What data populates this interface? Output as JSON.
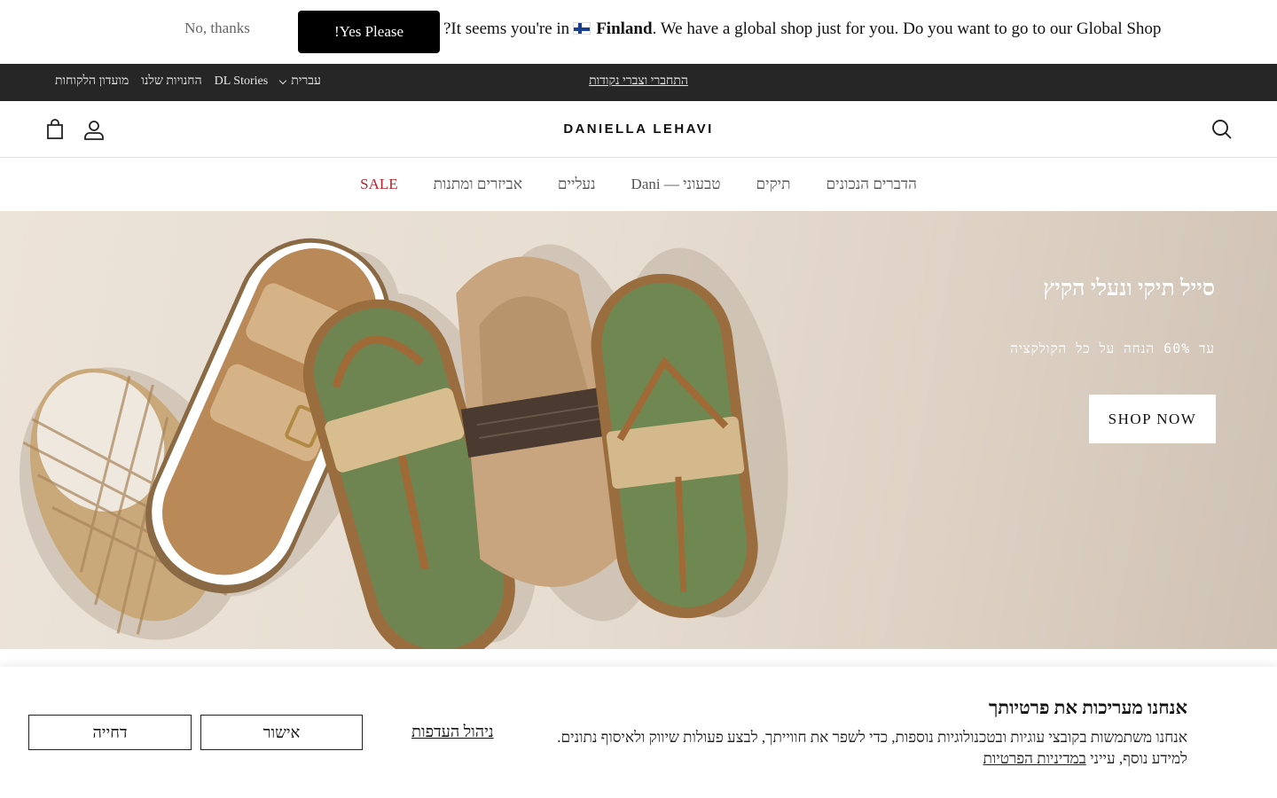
{
  "geo_banner": {
    "no_thanks": "No, thanks",
    "yes_please": "!Yes Please",
    "message_prefix": "?It seems you're in",
    "country": "Finland",
    "message_suffix": ". We have a global shop just for you. Do you want to go to our Global Shop"
  },
  "topbar": {
    "links": [
      "מועדון הלקוחות",
      "החנויות שלנו",
      "DL Stories"
    ],
    "language": "עברית",
    "promo": "התחברי וצברי נקודות"
  },
  "header": {
    "logo": "DANIELLA LEHAVI",
    "icons": [
      "cart-icon",
      "account-icon",
      "search-icon"
    ]
  },
  "nav": {
    "items": [
      "הדברים הנכונים",
      "תיקים",
      "Dani — טבעוני",
      "נעליים",
      "אביזרים ומתנות",
      "SALE"
    ]
  },
  "hero": {
    "title": "סייל תיקי ונעלי הקיץ",
    "subtitle": "עד 60% הנחה על כל הקולקציה",
    "button": "SHOP NOW",
    "image": "summer sandals and espadrilles on beige background"
  },
  "cookie": {
    "title": "אנחנו מעריכות את פרטיותך",
    "text": "אנחנו משתמשות בקובצי עוגיות ובטכנולוגיות נוספות, כדי לשפר את חווייתך, לבצע פעולות שיווק ולאיסוף נתונים. למידע נוסף, עייני",
    "policy_link": "במדיניות הפרטיות",
    "manage": "ניהול העדפות",
    "approve": "אישור",
    "reject": "דחייה"
  },
  "colors": {
    "topbar_bg": "#262626",
    "sale": "#b3262d",
    "yes_button": "#000000"
  }
}
